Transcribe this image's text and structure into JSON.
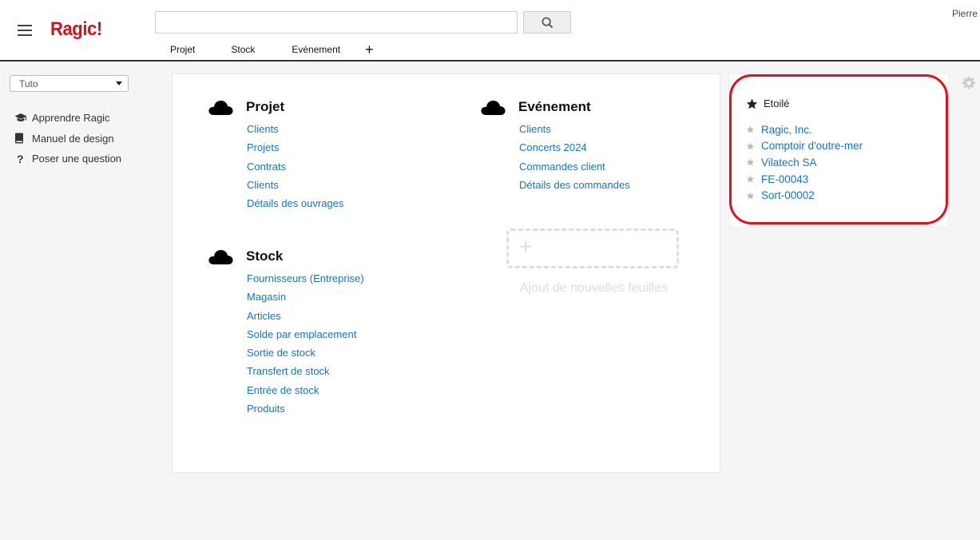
{
  "header": {
    "logo": "Ragic!",
    "search_value": "",
    "user_name": "Pierre A",
    "tabs": [
      {
        "label": "Projet"
      },
      {
        "label": "Stock"
      },
      {
        "label": "Evénement"
      }
    ],
    "add_tab_label": "+"
  },
  "sidebar": {
    "select_value": "Tuto",
    "links": [
      {
        "label": "Apprendre Ragic",
        "icon": "graduation-cap-icon"
      },
      {
        "label": "Manuel de design",
        "icon": "book-icon"
      },
      {
        "label": "Poser une question",
        "icon": "question-mark-icon"
      }
    ]
  },
  "main": {
    "groups": [
      {
        "title": "Projet",
        "icon": "cloud-icon",
        "links": [
          "Clients",
          "Projets",
          "Contrats",
          "Clients",
          "Détails des ouvrages"
        ]
      },
      {
        "title": "Stock",
        "icon": "cloud-icon",
        "links": [
          "Fournisseurs (Entreprise)",
          "Magasin",
          "Articles",
          "Solde par emplacement",
          "Sortie de stock",
          "Transfert de stock",
          "Entrée de stock",
          "Produits"
        ]
      },
      {
        "title": "Evénement",
        "icon": "cloud-icon",
        "links": [
          "Clients",
          "Concerts 2024",
          "Commandes client",
          "Détails des commandes"
        ]
      }
    ],
    "add_sheet_label": "Ajout de nouvelles feuilles",
    "add_sheet_plus": "+"
  },
  "starred": {
    "title": "Etoilé",
    "items": [
      "Ragic, Inc.",
      "Comptoir d'outre-mer",
      "Vilatech SA",
      "FE-00043",
      "Sort-00002"
    ]
  },
  "colors": {
    "brand": "#d2121a",
    "link": "#1a73b8",
    "highlight_outline": "#e3101b"
  }
}
